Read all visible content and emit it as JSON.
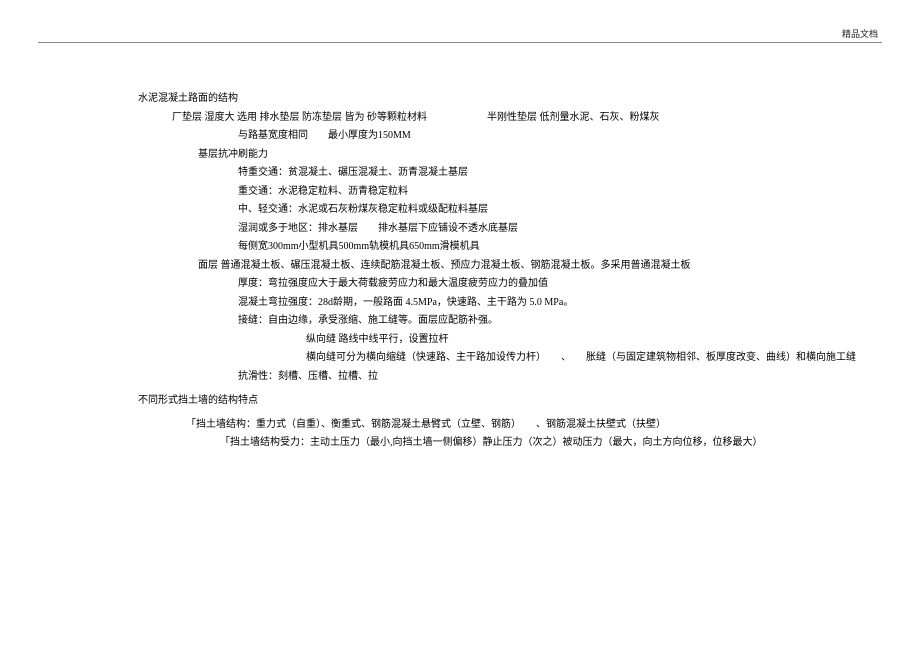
{
  "header": {
    "label": "精品文档"
  },
  "sec1": {
    "title": "水泥混凝土路面的结构",
    "dc_line": "厂垫层 湿度大 选用 排水垫层 防冻垫层 皆为 砂等颗粒材料　　　　　　半刚性垫层 低剂量水泥、石灰、粉煤灰",
    "dc_sub": "与路基宽度相同　　最小厚度为150MM",
    "jc_title": "基层抗冲刷能力",
    "jc_1": "特重交通：贫混凝土、碾压混凝土、沥青混凝土基层",
    "jc_2": "重交通：水泥稳定粒料、沥青稳定粒料",
    "jc_3": "中、轻交通：水泥或石灰粉煤灰稳定粒料或级配粒料基层",
    "jc_4": "湿润或多于地区：排水基层　　排水基层下应铺设不透水底基层",
    "jc_5": "每侧宽300mm小型机具500mm轨模机具650mm滑模机具",
    "mc_title": "面层 普通混凝土板、碾压混凝土板、连续配筋混凝土板、预应力混凝土板、钢筋混凝土板。多采用普通混凝土板",
    "mc_1": "厚度：弯拉强度应大于最大荷载疲劳应力和最大温度疲劳应力的叠加值",
    "mc_2": "混凝土弯拉强度：28d龄期，一般路面 4.5MPa，快速路、主干路为 5.0 MPa。",
    "mc_3": "接缝：自由边缘，承受涨缩、施工缝等。面层应配筋补强。",
    "mc_3a": "纵向缝 路线中线平行，设置拉杆",
    "mc_3b": "横向缝可分为横向缩缝（快速路、主干路加设传力杆）　　、　　胀缝（与固定建筑物相邻、板厚度改变、曲线）和横向施工缝",
    "mc_4": "抗滑性：刻槽、压槽、拉槽、拉"
  },
  "sec2": {
    "title": "不同形式挡土墙的结构特点",
    "line1": "「挡土墙结构：重力式（自重）、衡重式、钢筋混凝土悬臂式（立壁、钢筋）　　、钢筋混凝土扶壁式（扶壁）",
    "line2": "「挡土墙结构受力：主动土压力（最小,向挡土墙一侧偏移）静止压力（次之）被动压力（最大，向土方向位移，位移最大）"
  }
}
